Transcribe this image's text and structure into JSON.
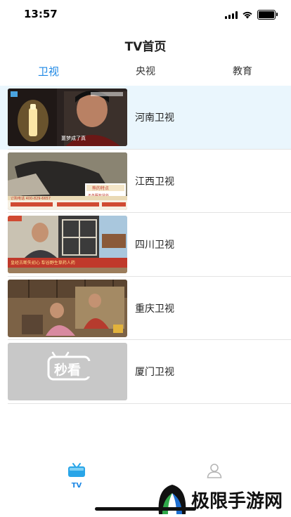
{
  "status_bar": {
    "time": "13:57"
  },
  "nav": {
    "title": "TV首页"
  },
  "tabs": [
    {
      "label": "卫视",
      "active": true
    },
    {
      "label": "央视",
      "active": false
    },
    {
      "label": "教育",
      "active": false
    }
  ],
  "channels": [
    {
      "name": "河南卫视",
      "thumb_icon": "drama-scene-thumbnail",
      "selected": true
    },
    {
      "name": "江西卫视",
      "thumb_icon": "animal-scene-thumbnail",
      "selected": false
    },
    {
      "name": "四川卫视",
      "thumb_icon": "interview-scene-thumbnail",
      "selected": false
    },
    {
      "name": "重庆卫视",
      "thumb_icon": "drama-interior-thumbnail",
      "selected": false
    },
    {
      "name": "厦门卫视",
      "thumb_icon": "placeholder-logo-thumbnail",
      "selected": false
    }
  ],
  "thumb_texts": {
    "ch1_subtitle": "噩梦成了真",
    "ch2_ad_title": "熊的特点",
    "ch2_ad_sub": "不冬眠有益处",
    "ch2_hotline": "订购电话 400-829-6657",
    "ch3_caption": "皇经古断失初心 犁谷野生草药人药",
    "placeholder_logo": "秒看"
  },
  "tabbar": {
    "items": [
      {
        "label": "TV",
        "icon": "tv-icon",
        "active": true
      },
      {
        "label": "",
        "icon": "user-icon",
        "active": false
      }
    ]
  },
  "watermark": {
    "text": "极限手游网"
  },
  "colors": {
    "accent": "#1e88e5",
    "selected_row": "#eaf6fd"
  }
}
